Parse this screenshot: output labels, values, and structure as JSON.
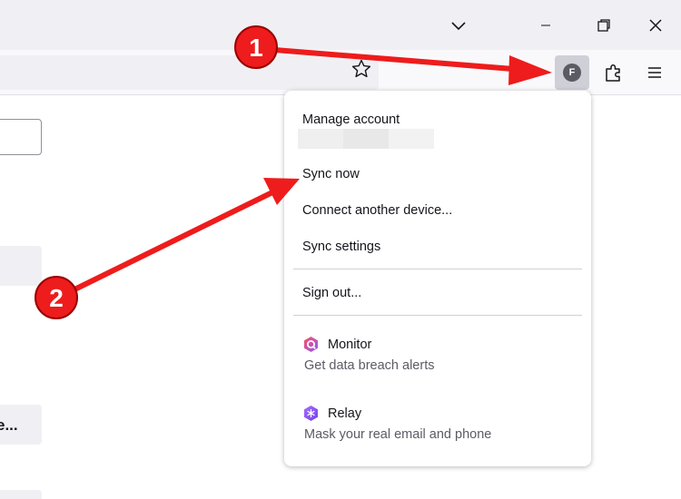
{
  "titlebar": {
    "tab_list_icon": "chevron-down-icon",
    "minimize_icon": "minimize-icon",
    "restore_icon": "restore-icon",
    "close_icon": "close-icon"
  },
  "toolbar": {
    "bookmark_icon": "star-icon",
    "account_avatar_letter": "F",
    "extensions_icon": "puzzle-icon",
    "menu_icon": "hamburger-icon"
  },
  "page": {
    "partial_button_label": "e..."
  },
  "account_panel": {
    "manage_account": "Manage account",
    "sync_now": "Sync now",
    "connect_device": "Connect another device...",
    "sync_settings": "Sync settings",
    "sign_out": "Sign out...",
    "services": [
      {
        "name": "Monitor",
        "description": "Get data breach alerts",
        "icon": "monitor-icon",
        "color": "#e3316f"
      },
      {
        "name": "Relay",
        "description": "Mask your real email and phone",
        "icon": "relay-icon",
        "color": "#9059ff"
      }
    ]
  },
  "annotations": [
    {
      "number": "1",
      "color": "#ee1c1c"
    },
    {
      "number": "2",
      "color": "#ee1c1c"
    }
  ]
}
